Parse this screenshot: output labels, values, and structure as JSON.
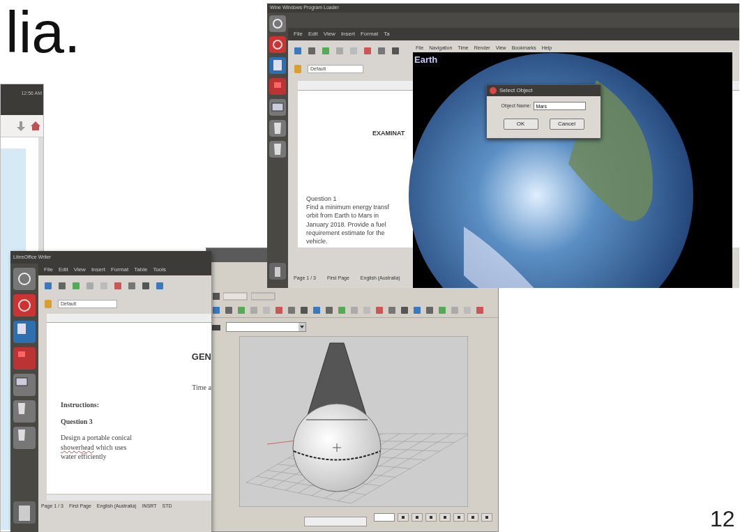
{
  "slide": {
    "title_fragment": "lia.",
    "page_number": "12"
  },
  "back_window": {
    "clock": "12:56 AM"
  },
  "upper_desktop": {
    "panel_title": "Wine Windows Program Loader",
    "writer": {
      "menus": [
        "File",
        "Edit",
        "View",
        "Insert",
        "Format",
        "Ta"
      ],
      "style": "Default",
      "lines": [
        {
          "kind": "heading",
          "text": "EXAMINAT"
        },
        {
          "kind": "text",
          "text": "Question 1"
        },
        {
          "kind": "text",
          "text": "Find a minimum energy transf"
        },
        {
          "kind": "text",
          "text": "orbit from Earth to Mars in"
        },
        {
          "kind": "text",
          "text": "January 2018. Provide a fuel"
        },
        {
          "kind": "text",
          "text": "requirement estimate for the"
        },
        {
          "kind": "text",
          "text": "vehicle."
        }
      ],
      "status": [
        "Page 1 / 3",
        "First Page",
        "English (Australia)"
      ]
    },
    "celestia": {
      "menus": [
        "File",
        "Navigation",
        "Time",
        "Render",
        "View",
        "Bookmarks",
        "Help"
      ],
      "object": "Earth",
      "dialog": {
        "title": "Select Object",
        "label": "Object Name:",
        "value": "Mars",
        "buttons": [
          "OK",
          "Cancel"
        ]
      }
    }
  },
  "lower_writer": {
    "title": "LibreOffice Writer",
    "menus": [
      "File",
      "Edit",
      "View",
      "Insert",
      "Format",
      "Table",
      "Tools"
    ],
    "style": "Default",
    "lines": [
      {
        "kind": "heading",
        "segments": [
          {
            "text": "GEN",
            "misspelled": false
          }
        ]
      },
      {
        "kind": "right",
        "segments": [
          {
            "text": "Time a",
            "misspelled": false
          }
        ]
      },
      {
        "kind": "bold",
        "segments": [
          {
            "text": "Instructions:",
            "misspelled": false
          }
        ]
      },
      {
        "kind": "bold",
        "segments": [
          {
            "text": "Question 3",
            "misspelled": false
          }
        ]
      },
      {
        "kind": "text",
        "segments": [
          {
            "text": "Design a portable conical",
            "misspelled": false
          }
        ]
      },
      {
        "kind": "text",
        "segments": [
          {
            "text": "showerhead",
            "misspelled": true
          },
          {
            "text": " which uses",
            "misspelled": false
          }
        ]
      },
      {
        "kind": "text",
        "segments": [
          {
            "text": "water efficiently",
            "misspelled": false
          }
        ]
      }
    ],
    "status": [
      "Page 1 / 3",
      "First Page",
      "English (Australia)",
      "INSRT",
      "STD"
    ]
  }
}
